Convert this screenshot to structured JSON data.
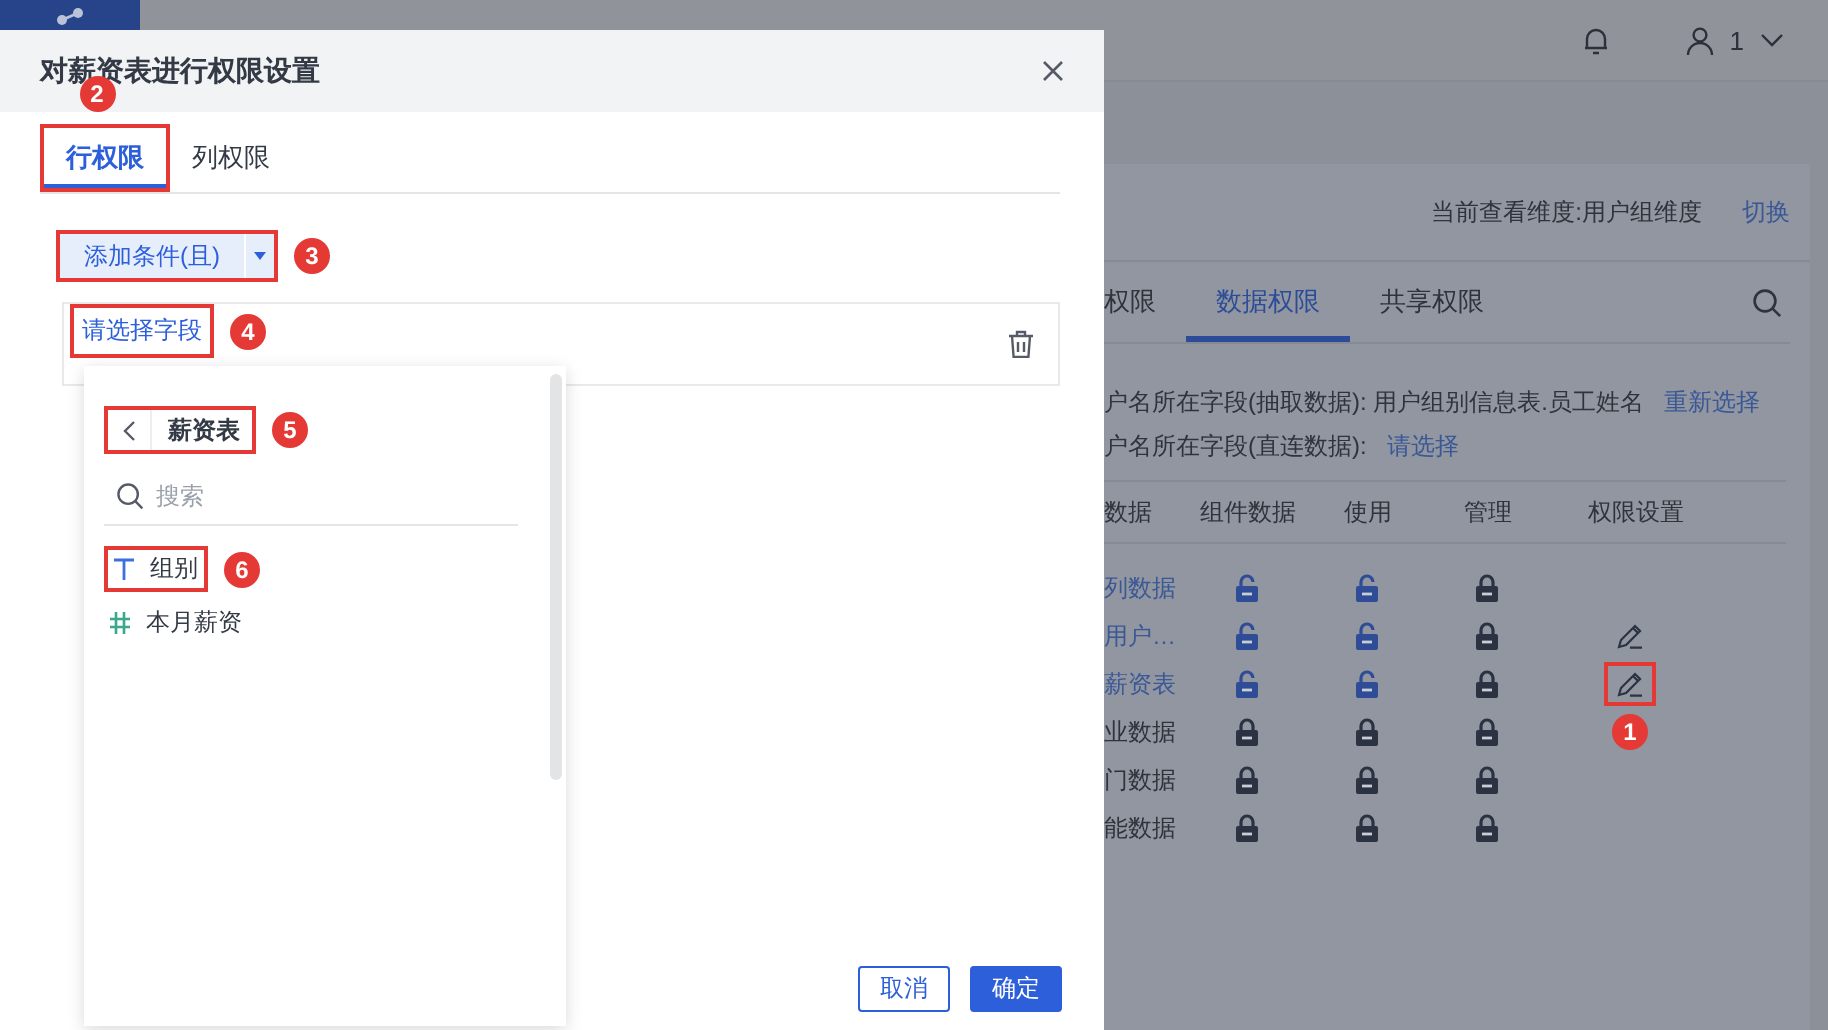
{
  "app_header": {
    "user": "1"
  },
  "panel": {
    "dimension_label": "当前查看维度:用户组维度",
    "switch_link": "切换",
    "tabs": [
      {
        "label": "权限",
        "selected": false
      },
      {
        "label": "数据权限",
        "selected": true
      },
      {
        "label": "共享权限",
        "selected": false
      }
    ],
    "field_lines": [
      {
        "label": "户名所在字段(抽取数据): 用户组别信息表.员工姓名",
        "link": "重新选择"
      },
      {
        "label": "户名所在字段(直连数据):",
        "link": "请选择"
      }
    ],
    "table": {
      "columns": [
        "数据",
        "组件数据",
        "使用",
        "管理",
        "权限设置"
      ],
      "rows": [
        {
          "name": "列数据",
          "link": true,
          "component_data_locked": false,
          "use_locked": false,
          "manage_locked": true,
          "editable": false
        },
        {
          "name": "用户…",
          "link": true,
          "component_data_locked": false,
          "use_locked": false,
          "manage_locked": true,
          "editable": true
        },
        {
          "name": "薪资表",
          "link": true,
          "component_data_locked": false,
          "use_locked": false,
          "manage_locked": true,
          "editable": true,
          "callout": "1"
        },
        {
          "name": "业数据",
          "link": false,
          "component_data_locked": true,
          "use_locked": true,
          "manage_locked": true,
          "editable": false
        },
        {
          "name": "门数据",
          "link": false,
          "component_data_locked": true,
          "use_locked": true,
          "manage_locked": true,
          "editable": false
        },
        {
          "name": "能数据",
          "link": false,
          "component_data_locked": true,
          "use_locked": true,
          "manage_locked": true,
          "editable": false
        }
      ]
    }
  },
  "dialog": {
    "title": "对薪资表进行权限设置",
    "tabs": [
      {
        "label": "行权限",
        "selected": true,
        "callout": "2"
      },
      {
        "label": "列权限",
        "selected": false
      }
    ],
    "add_condition_button": {
      "label": "添加条件(且)",
      "callout": "3"
    },
    "condition": {
      "field_placeholder": "请选择字段",
      "callout": "4"
    },
    "field_picker": {
      "table_name": "薪资表",
      "callout": "5",
      "search_placeholder": "搜索",
      "fields": [
        {
          "name": "组别",
          "kind": "text",
          "callout": "6"
        },
        {
          "name": "本月薪资",
          "kind": "number"
        }
      ]
    },
    "buttons": [
      {
        "label": "取消",
        "kind": "secondary"
      },
      {
        "label": "确定",
        "kind": "primary"
      }
    ]
  }
}
